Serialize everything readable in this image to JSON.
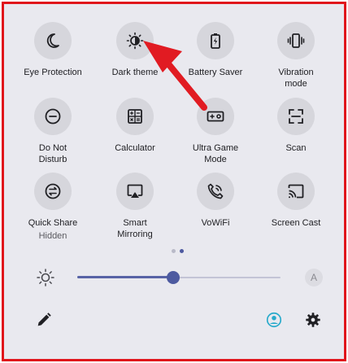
{
  "tiles": [
    {
      "label": "Eye Protection",
      "icon": "moon-icon"
    },
    {
      "label": "Dark theme",
      "icon": "contrast-icon"
    },
    {
      "label": "Battery Saver",
      "icon": "battery-icon"
    },
    {
      "label": "Vibration mode",
      "icon": "vibration-icon"
    },
    {
      "label": "Do Not Disturb",
      "icon": "minus-circle-icon"
    },
    {
      "label": "Calculator",
      "icon": "calculator-icon"
    },
    {
      "label": "Ultra Game Mode",
      "icon": "game-icon"
    },
    {
      "label": "Scan",
      "icon": "scan-icon"
    },
    {
      "label": "Quick Share",
      "sublabel": "Hidden",
      "icon": "quick-share-icon"
    },
    {
      "label": "Smart Mirroring",
      "icon": "mirroring-icon"
    },
    {
      "label": "VoWiFi",
      "icon": "wifi-call-icon"
    },
    {
      "label": "Screen Cast",
      "icon": "cast-icon"
    }
  ],
  "page_indicator": {
    "pages": 2,
    "active": 2
  },
  "brightness": {
    "level": 0.47,
    "auto_label": "A"
  },
  "colors": {
    "frame_border": "#e0141b",
    "panel_bg": "#e9e9ef",
    "tile_bg": "#d6d6dc",
    "accent": "#4d5aa0",
    "user_accent": "#27aacb",
    "arrow": "#e11b22"
  },
  "bottom_bar": {
    "left_icon": "edit-icon",
    "right_icons": [
      "user-icon",
      "settings-icon"
    ]
  }
}
